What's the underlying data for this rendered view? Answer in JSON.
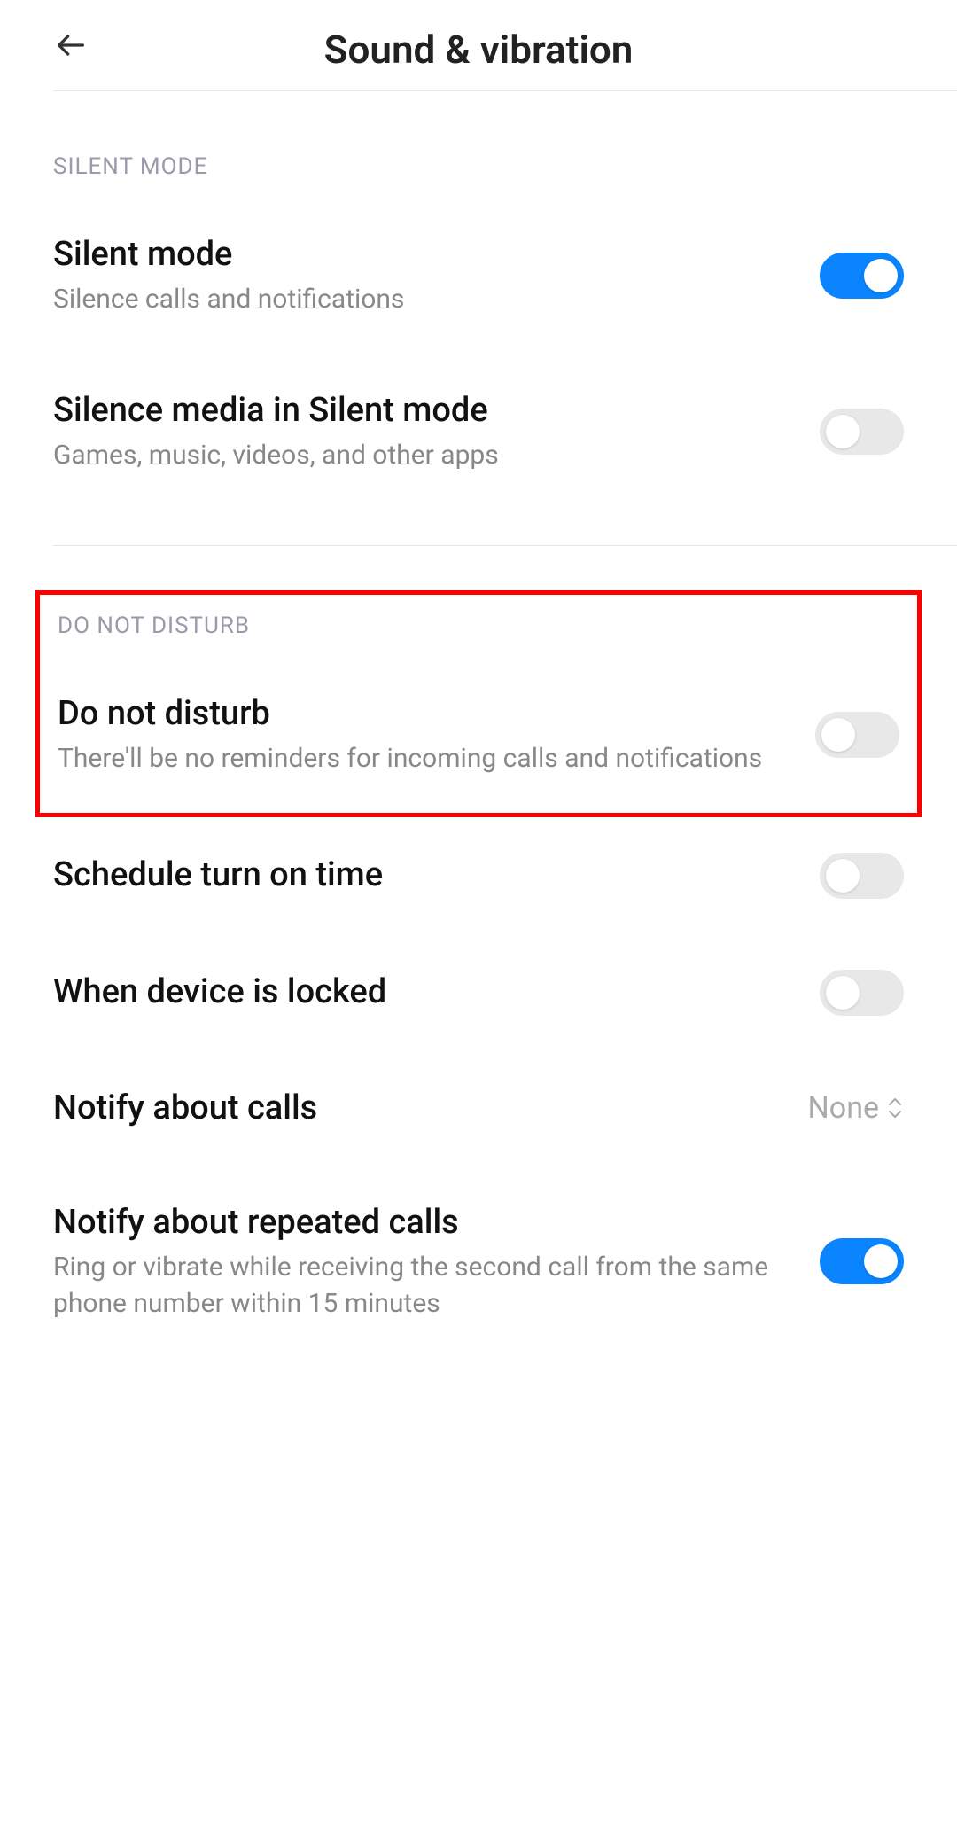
{
  "header": {
    "title": "Sound & vibration"
  },
  "sections": {
    "silent": {
      "header": "SILENT MODE",
      "silent_mode": {
        "title": "Silent mode",
        "subtitle": "Silence calls and notifications",
        "enabled": true
      },
      "silence_media": {
        "title": "Silence media in Silent mode",
        "subtitle": "Games, music, videos, and other apps",
        "enabled": false
      }
    },
    "dnd": {
      "header": "DO NOT DISTURB",
      "do_not_disturb": {
        "title": "Do not disturb",
        "subtitle": "There'll be no reminders for incoming calls and notifications",
        "enabled": false
      },
      "schedule": {
        "title": "Schedule turn on time",
        "enabled": false
      },
      "locked": {
        "title": "When device is locked",
        "enabled": false
      },
      "notify_calls": {
        "title": "Notify about calls",
        "value": "None"
      },
      "repeated_calls": {
        "title": "Notify about repeated calls",
        "subtitle": "Ring or vibrate while receiving the second call from the same phone number within 15 minutes",
        "enabled": true
      }
    }
  }
}
